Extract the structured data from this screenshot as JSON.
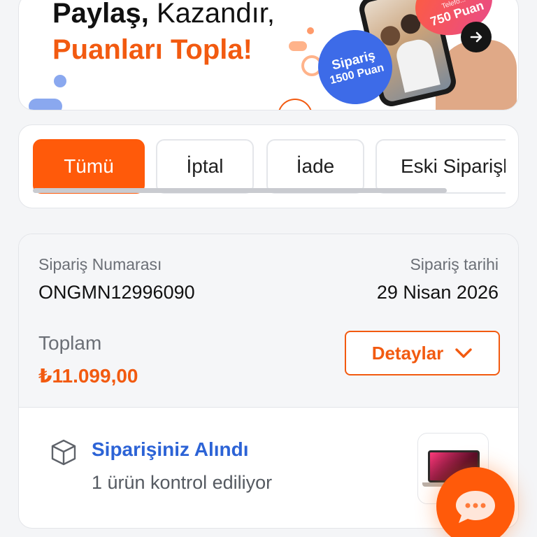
{
  "banner": {
    "line1_bold": "Paylaş,",
    "line1_rest": " Kazandır,",
    "line2": "Puanları Topla!",
    "badge_title": "Sipariş",
    "badge_points": "1500 Puan",
    "points_small": "Telefo...",
    "points_big": "750 Puan",
    "accent_color": "#f25a10",
    "badge_color": "#3d6be8",
    "arrow_icon": "arrow-right-icon"
  },
  "tabs": {
    "items": [
      {
        "label": "Tümü",
        "active": true
      },
      {
        "label": "İptal",
        "active": false
      },
      {
        "label": "İade",
        "active": false
      },
      {
        "label": "Eski Siparişler",
        "active": false
      }
    ],
    "active_color": "#ff5a0a"
  },
  "order": {
    "number_label": "Sipariş Numarası",
    "number": "ONGMN12996090",
    "date_label": "Sipariş tarihi",
    "date": "29 Nisan 2026",
    "total_label": "Toplam",
    "total": "₺11.099,00",
    "details_label": "Detaylar",
    "status_icon": "package-box-icon",
    "status_title": "Siparişiniz Alındı",
    "status_sub": "1 ürün kontrol ediliyor",
    "status_color": "#2c63d6"
  },
  "chat": {
    "icon": "chat-bubble-icon"
  }
}
